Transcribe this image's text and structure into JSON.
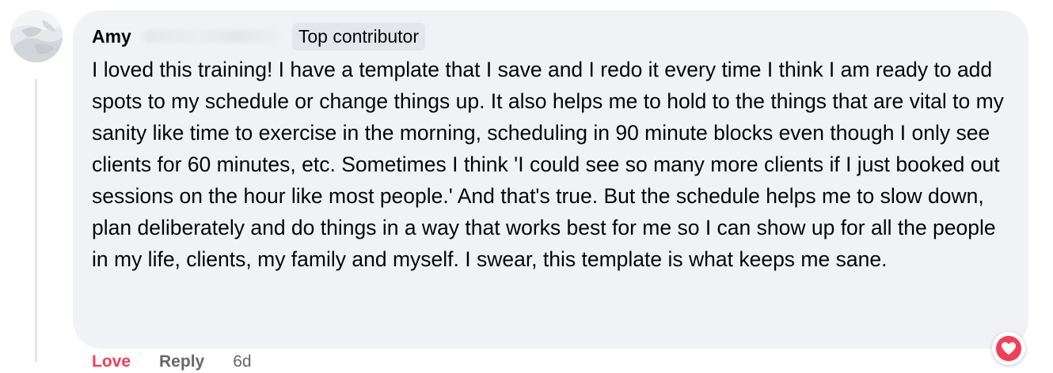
{
  "comment": {
    "author": "Amy",
    "badge": "Top contributor",
    "text": "I loved this training! I have a template that I save and I redo it every time I think I am ready to add spots to my schedule or change things up. It also helps me to hold to the things that are vital to my sanity like time to exercise in the morning, scheduling in 90 minute blocks even though I only see clients for 60 minutes, etc. Sometimes I think 'I could see so many more clients if I just booked out sessions on the hour like most people.' And that's true. But the schedule helps me to slow down, plan deliberately and do things in a way that works best for me so I can show up for all the people in my life, clients, my family and myself. I swear, this template is what keeps me sane.",
    "actions": {
      "love": "Love",
      "reply": "Reply",
      "time": "6d"
    },
    "reaction_icon": "love-heart-icon"
  },
  "colors": {
    "bubble": "#f0f2f5",
    "love": "#f33e58",
    "muted": "#65676b"
  }
}
